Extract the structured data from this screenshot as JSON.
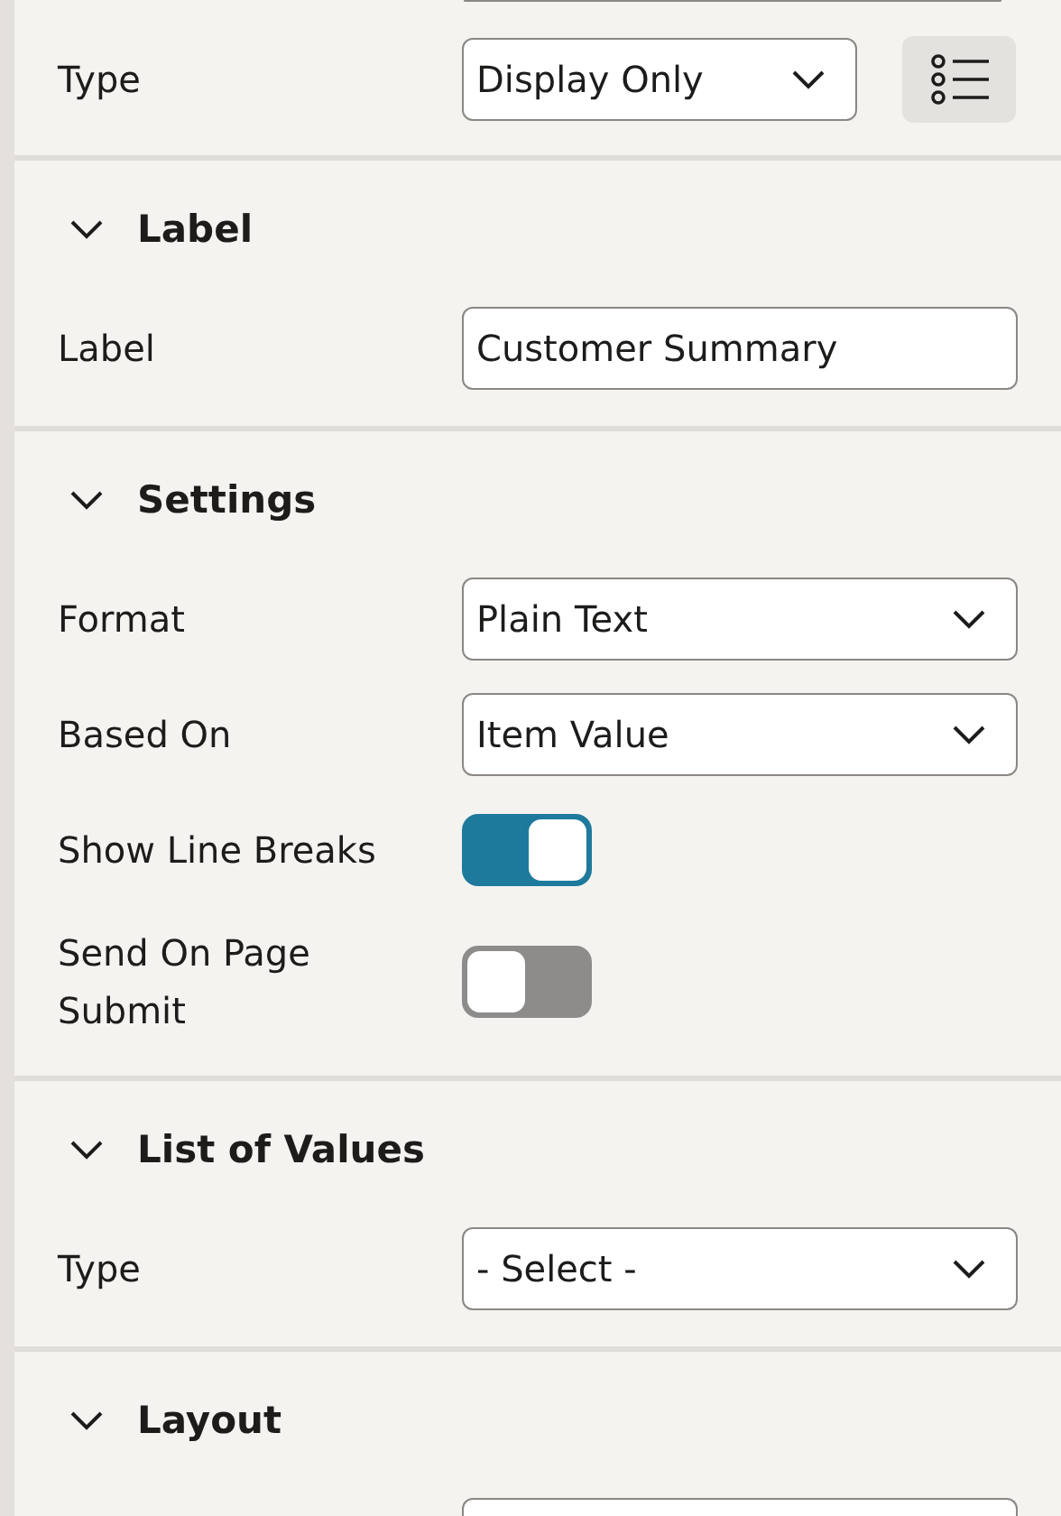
{
  "top_row": {
    "label": "Type",
    "value": "Display Only"
  },
  "sections": [
    {
      "title": "Label",
      "expanded": true,
      "fields": [
        {
          "kind": "text",
          "label": "Label",
          "value": "Customer Summary"
        }
      ]
    },
    {
      "title": "Settings",
      "expanded": true,
      "fields": [
        {
          "kind": "select",
          "label": "Format",
          "value": "Plain Text"
        },
        {
          "kind": "select",
          "label": "Based On",
          "value": "Item Value"
        },
        {
          "kind": "toggle",
          "label": "Show Line Breaks",
          "on": true
        },
        {
          "kind": "toggle",
          "label": "Send On Page Submit",
          "on": false
        }
      ]
    },
    {
      "title": "List of Values",
      "expanded": true,
      "fields": [
        {
          "kind": "select",
          "label": "Type",
          "value": "- Select -"
        }
      ]
    },
    {
      "title": "Layout",
      "expanded": true
    }
  ]
}
